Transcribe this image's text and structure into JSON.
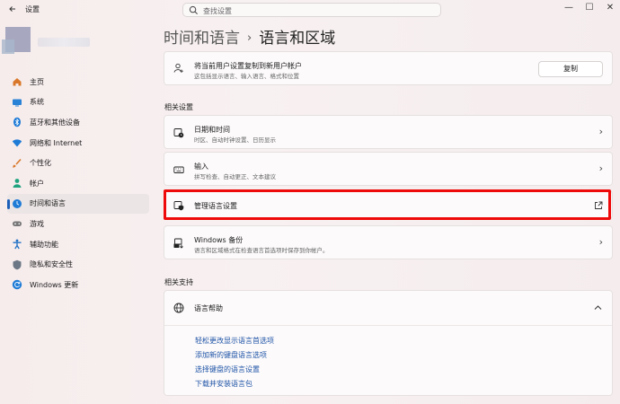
{
  "window": {
    "title": "设置",
    "controls": [
      "—",
      "☐",
      "✕"
    ]
  },
  "search": {
    "placeholder": "查找设置"
  },
  "breadcrumb": {
    "parent": "时间和语言",
    "separator": "›",
    "current": "语言和区域"
  },
  "sidebar": {
    "items": [
      {
        "label": "主页",
        "icon": "home-icon"
      },
      {
        "label": "系统",
        "icon": "system-icon"
      },
      {
        "label": "蓝牙和其他设备",
        "icon": "bluetooth-icon"
      },
      {
        "label": "网络和 Internet",
        "icon": "wifi-icon"
      },
      {
        "label": "个性化",
        "icon": "brush-icon"
      },
      {
        "label": "帐户",
        "icon": "account-icon"
      },
      {
        "label": "时间和语言",
        "icon": "clock-globe-icon",
        "active": true
      },
      {
        "label": "游戏",
        "icon": "gamepad-icon"
      },
      {
        "label": "辅助功能",
        "icon": "accessibility-icon"
      },
      {
        "label": "隐私和安全性",
        "icon": "shield-icon"
      },
      {
        "label": "Windows 更新",
        "icon": "update-icon"
      }
    ]
  },
  "copy_card": {
    "title": "将当前用户设置复制到新用户帐户",
    "subtitle": "这包括显示语言、输入语言、格式和位置",
    "button": "复制"
  },
  "related_settings": {
    "heading": "相关设置",
    "items": [
      {
        "title": "日期和时间",
        "subtitle": "时区、自动时钟设置、日历显示",
        "icon": "calendar-clock-icon",
        "action": "chevron"
      },
      {
        "title": "输入",
        "subtitle": "拼写检查、自动更正、文本建议",
        "icon": "keyboard-icon",
        "action": "chevron"
      },
      {
        "title": "管理语言设置",
        "subtitle": "",
        "icon": "language-admin-icon",
        "action": "external-link"
      },
      {
        "title": "Windows 备份",
        "subtitle": "语言和区域格式在检查语言首选项时保存到你帐户。",
        "icon": "backup-icon",
        "action": "chevron"
      }
    ]
  },
  "related_support": {
    "heading": "相关支持",
    "help_title": "语言帮助",
    "links": [
      "轻松更改显示语言首选项",
      "添加新的键盘语言选项",
      "选择键盘的语言设置",
      "下载并安装语言包"
    ]
  },
  "colors": {
    "accent": "#1c5fb8",
    "highlight": "#ee0a0a",
    "link": "#1f54a8"
  }
}
